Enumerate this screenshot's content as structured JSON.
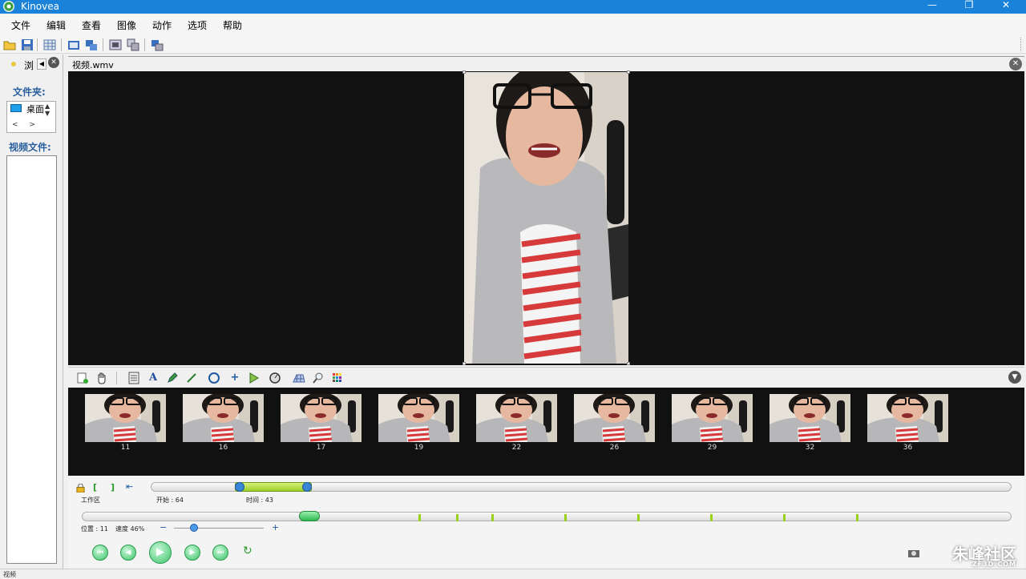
{
  "window": {
    "title": "Kinovea"
  },
  "menu": [
    "文件",
    "编辑",
    "查看",
    "图像",
    "动作",
    "选项",
    "帮助"
  ],
  "left_panel": {
    "tab_label": "浏",
    "folders_label": "文件夹:",
    "folder_item": "桌面",
    "videos_label": "视频文件:"
  },
  "video_tab": {
    "title": "视频.wmv"
  },
  "thumbnails": [
    "11",
    "16",
    "17",
    "19",
    "22",
    "26",
    "29",
    "32",
    "36"
  ],
  "working_zone": {
    "label": "工作区",
    "start_label": "开始 : 64",
    "duration_label": "时间 : 43"
  },
  "playback": {
    "position_label": "位置 : 11",
    "speed_label": "速度 46%",
    "minus": "−",
    "plus": "+"
  },
  "status": {
    "text": "视频"
  },
  "watermark": {
    "text": "朱峰社区",
    "sub": "ZF3D.COM"
  }
}
